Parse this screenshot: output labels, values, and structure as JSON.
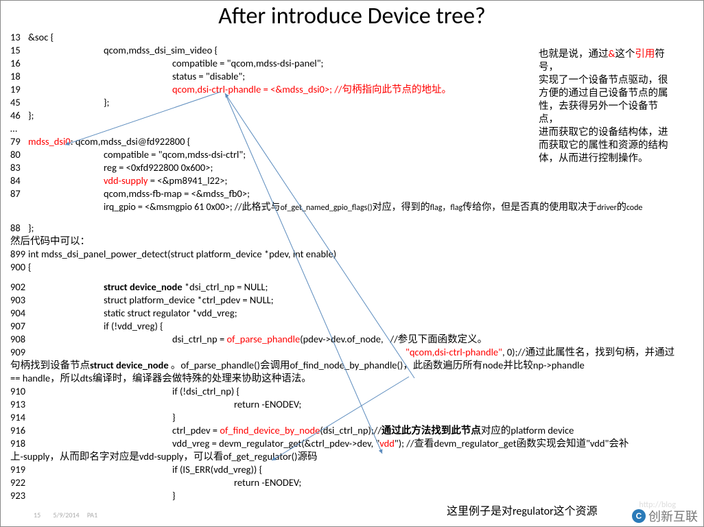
{
  "title": "After introduce Device tree?",
  "footer": {
    "date": "5/9/2014",
    "label": "PA1",
    "page_badge": "15"
  },
  "watermark": {
    "text": "创新互联",
    "url_fragment": "http://blog"
  },
  "side_note": {
    "l1": "也就是说，通过",
    "l1_red": "&",
    "l1_b": "这个",
    "l1_red2": "引用",
    "l1_c": "符号，",
    "l2": "实现了一个设备节点驱动，很",
    "l3": "方便的通过自己设备节点的属",
    "l4": "性，去获得另外一个设备节点，",
    "l5": "进而获取它的设备结构体，进",
    "l6": "而获取它的属性和资源的结构",
    "l7": "体，从而进行控制操作。"
  },
  "bottom_note": "这里例子是对regulator这个资源",
  "lines": {
    "l13": {
      "num": "13",
      "text": "&soc {"
    },
    "l15": {
      "num": "15",
      "text": "qcom,mdss_dsi_sim_video {"
    },
    "l16": {
      "num": "16",
      "text": "compatible = \"qcom,mdss-dsi-panel\";"
    },
    "l18": {
      "num": "18",
      "text": "status = \"disable\";"
    },
    "l19": {
      "num": "19",
      "text_a": "qcom,dsi-ctrl-phandle = <",
      "text_red": "&mdss_dsi0",
      "text_b": ">; //句柄指向此节点的地址。"
    },
    "l45": {
      "num": "45",
      "text": "};"
    },
    "l46": {
      "num": "46",
      "text": "};"
    },
    "ellipsis": "…",
    "l79": {
      "num": "79",
      "red": "mdss_dsi0",
      "text": ": qcom,mdss_dsi@fd922800 {"
    },
    "l80": {
      "num": "80",
      "text": "compatible = \"qcom,mdss-dsi-ctrl\";"
    },
    "l83": {
      "num": "83",
      "text": "reg = <0xfd922800 0x600>;"
    },
    "l84": {
      "num": "84",
      "red": "vdd-supply",
      "text": " = <&pm8941_l22>;"
    },
    "l87": {
      "num": "87",
      "text": "qcom,mdss-fb-map = <&mdss_fb0>;"
    },
    "l87b": {
      "text_a": "irq_gpio = <&msmgpio 61 0x00>; //此格式与",
      "text_sm": "of_get_named_gpio_flags()",
      "text_b": "对应，得到的",
      "text_c": "flag，flag",
      "text_d": "传给你，但是否真的使用取决于",
      "text_e": "driver",
      "text_f": "的",
      "text_g": "code"
    },
    "l88": {
      "num": "88",
      "text": "};"
    },
    "zh1": "然后代码中可以：",
    "l899": {
      "num": "899",
      "text": "int mdss_dsi_panel_power_detect(struct platform_device *pdev, int enable)"
    },
    "l900": {
      "num": "900",
      "text": "{"
    },
    "l902": {
      "num": "902",
      "bold": "struct device_node",
      "text": " *dsi_ctrl_np = NULL;"
    },
    "l903": {
      "num": "903",
      "text": "struct platform_device *ctrl_pdev = NULL;"
    },
    "l904": {
      "num": "904",
      "text": "static struct regulator *vdd_vreg;"
    },
    "l907": {
      "num": "907",
      "text": "if (!vdd_vreg) {"
    },
    "l908": {
      "num": "908",
      "text_a": "dsi_ctrl_np = ",
      "red": "of_parse_phandle",
      "text_b": "(pdev->dev.of_node,   //参见下面函数定义。"
    },
    "l909": {
      "num": "909",
      "red": "\"qcom,dsi-ctrl-phandle\"",
      "text": ", 0);//通过此属性名，找到句柄，并通过"
    },
    "l909b": {
      "a": "句柄找到设备节点",
      "bold": "struct device_node",
      "b": " 。of_parse_phandle()会调用of_find_node_by_phandle()，此函数遍历所有node并比较np->phandle "
    },
    "l909c": "== handle，所以dts编译时，编译器会做特殊的处理来协助这种语法。",
    "l910": {
      "num": "910",
      "text": "if (!dsi_ctrl_np) {"
    },
    "l913": {
      "num": "913",
      "text": "return -ENODEV;"
    },
    "l914": {
      "num": "914",
      "text": "}"
    },
    "l916": {
      "num": "916",
      "text_a": "ctrl_pdev = ",
      "red": "of_find_device_by_node",
      "text_b": "(dsi_ctrl_np);//",
      "bold": "通过此方法找到此节点",
      "text_c": "对应的platform device"
    },
    "l918": {
      "num": "918",
      "text_a": "vdd_vreg = devm_regulator_get(&ctrl_pdev->dev, \"",
      "red": "vdd",
      "text_b": "\"); //查看devm_regulator_get函数实现会知道\"vdd\"会补"
    },
    "l918b": "上-supply，从而即名字对应是vdd-supply，可以看of_get_regulator()源码",
    "l919": {
      "num": "919",
      "text": "if (IS_ERR(vdd_vreg)) {"
    },
    "l922": {
      "num": "922",
      "text": "return -ENODEV;"
    },
    "l923": {
      "num": "923",
      "text": "}"
    }
  }
}
